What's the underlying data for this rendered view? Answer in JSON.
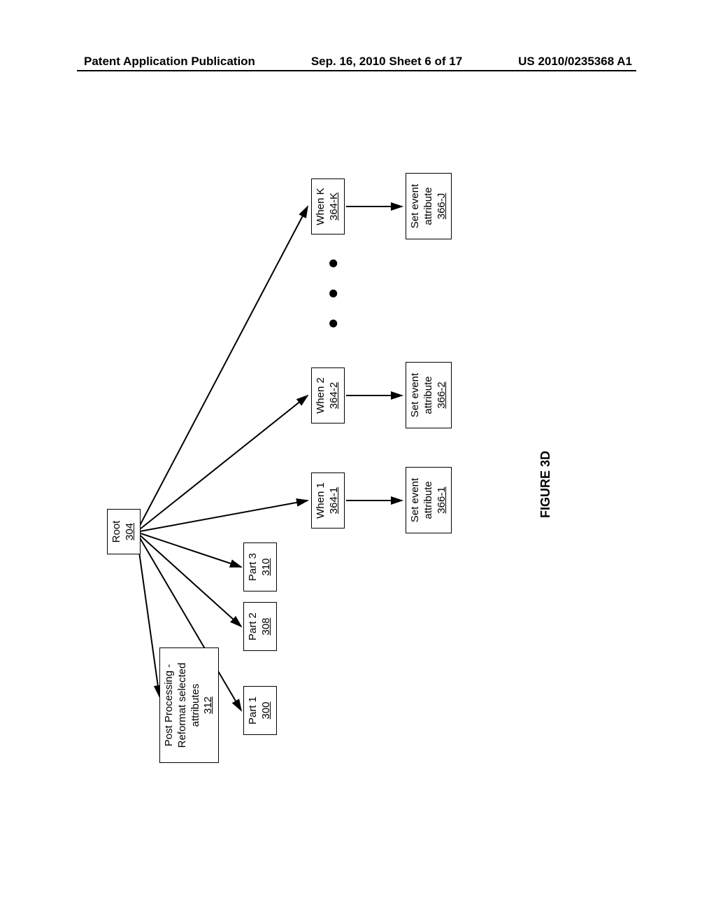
{
  "header": {
    "left": "Patent Application Publication",
    "center": "Sep. 16, 2010  Sheet 6 of 17",
    "right": "US 2010/0235368 A1"
  },
  "figure_caption": "FIGURE 3D",
  "diagram": {
    "root": {
      "label": "Root",
      "ref": "304"
    },
    "post_processing": {
      "line1": "Post Processing -",
      "line2": "Reformat selected",
      "line3": "attributes",
      "ref": "312"
    },
    "parts": [
      {
        "label": "Part 1",
        "ref": "300"
      },
      {
        "label": "Part 2",
        "ref": "308"
      },
      {
        "label": "Part 3",
        "ref": "310"
      }
    ],
    "when": [
      {
        "label": "When 1",
        "ref": "364-1"
      },
      {
        "label": "When 2",
        "ref": "364-2"
      },
      {
        "label": "When K",
        "ref": "364-K"
      }
    ],
    "set_event": [
      {
        "line1": "Set event",
        "line2": "attribute",
        "ref": "366-1"
      },
      {
        "line1": "Set event",
        "line2": "attribute",
        "ref": "366-2"
      },
      {
        "line1": "Set event",
        "line2": "attribute",
        "ref": "366-J"
      }
    ],
    "dots": "● ● ●"
  }
}
